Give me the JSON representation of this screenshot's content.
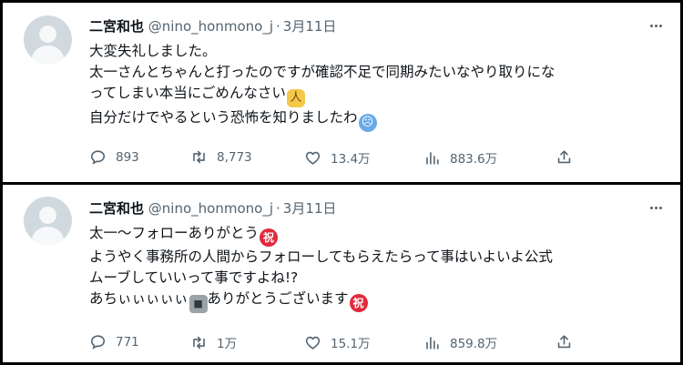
{
  "tweets": [
    {
      "author_name": "二宮和也",
      "handle": "@nino_honmono_j",
      "separator": "·",
      "date": "3月11日",
      "lines": [
        {
          "text": "大変失礼しました。"
        },
        {
          "text": "太一さんとちゃんと打ったのですが確認不足で同期みたいなやり取りにな"
        },
        {
          "text": "ってしまい本当にごめんなさい",
          "emoji_after": "person-bowing-emoji"
        },
        {
          "text": "自分だけでやるという恐怖を知りましたわ",
          "emoji_after": "cold-face-emoji"
        }
      ],
      "reply_count": "893",
      "retweet_count": "8,773",
      "like_count": "13.4万",
      "view_count": "883.6万"
    },
    {
      "author_name": "二宮和也",
      "handle": "@nino_honmono_j",
      "separator": "·",
      "date": "3月11日",
      "lines": [
        {
          "text": "太一〜フォローありがとう",
          "emoji_after": "congratulations-emoji"
        },
        {
          "text": "ようやく事務所の人間からフォローしてもらえたらって事はいよいよ公式"
        },
        {
          "text": "ムーブしていいって事ですよね!?"
        },
        {
          "text": "あちぃぃぃぃぃ",
          "emoji_after": "moai-emoji",
          "text_after": "ありがとうございます",
          "emoji_end": "congratulations-emoji"
        }
      ],
      "reply_count": "771",
      "retweet_count": "1万",
      "like_count": "15.1万",
      "view_count": "859.8万"
    }
  ],
  "emoji_glyphs": {
    "congratulations": "祝",
    "moai": "■",
    "person_bowing": "人",
    "cold_face": "☹"
  },
  "colors": {
    "text_primary": "#0f1419",
    "text_secondary": "#536471",
    "frame_border": "#000000"
  }
}
